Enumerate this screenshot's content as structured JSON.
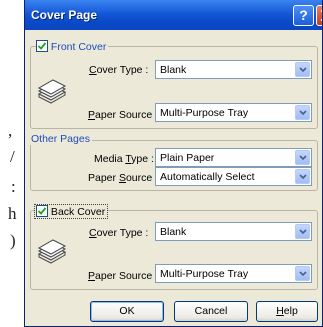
{
  "background_fragments": [
    ",",
    "/",
    ":",
    "h",
    ")"
  ],
  "dialog": {
    "title": "Cover Page",
    "help_glyph": "?"
  },
  "front_cover": {
    "label_prefix": "",
    "label_accel": "F",
    "label_rest": "ront Cover",
    "checked": true,
    "cover_type": {
      "accel": "C",
      "rest": "over Type :",
      "value": "Blank"
    },
    "paper_source": {
      "accel": "P",
      "rest": "aper Source :",
      "value": "Multi-Purpose Tray"
    },
    "icon": "paper-stack-icon"
  },
  "other_pages": {
    "label": "Other Pages",
    "media_type": {
      "prefix": "Media ",
      "accel": "T",
      "rest": "ype :",
      "value": "Plain Paper"
    },
    "paper_source": {
      "prefix": "Paper ",
      "accel": "S",
      "rest": "ource :",
      "value": "Automatically Select"
    }
  },
  "back_cover": {
    "label_accel": "B",
    "label_rest": "ack Cover",
    "checked": true,
    "cover_type": {
      "accel": "C",
      "rest": "over Type :",
      "value": "Blank"
    },
    "paper_source": {
      "accel": "P",
      "rest": "aper Source :",
      "value": "Multi-Purpose Tray"
    },
    "icon": "paper-stack-icon"
  },
  "buttons": {
    "ok": "OK",
    "cancel": "Cancel",
    "help_accel": "H",
    "help_rest": "elp"
  },
  "colors": {
    "titlebar": "#0b4bc9",
    "dialog_bg": "#ece9d8",
    "group_label_blue": "#1b4dbc",
    "combo_border": "#7f9db9",
    "checkmark": "#21a121"
  }
}
